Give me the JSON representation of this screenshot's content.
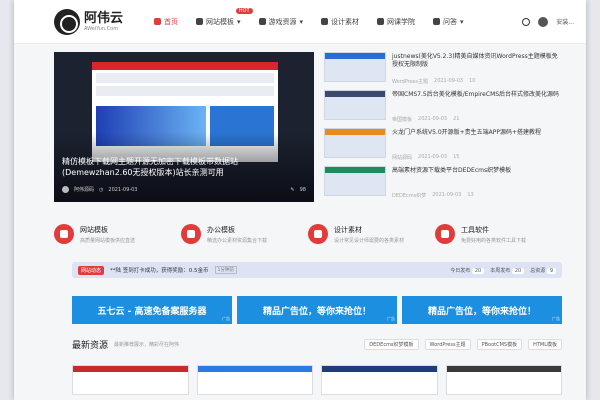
{
  "brand": {
    "name": "阿伟云",
    "domain": "AWeiYun.Com"
  },
  "nav": {
    "items": [
      {
        "label": "首页"
      },
      {
        "label": "网站模板"
      },
      {
        "label": "游戏资源"
      },
      {
        "label": "设计素材"
      },
      {
        "label": "网课学院"
      },
      {
        "label": "问答"
      }
    ],
    "hot_badge": "HOT",
    "user_label": "安装..."
  },
  "hero": {
    "title": "精仿模板下载网主题开源无加密下载模板带数据站(Demewzhan2.60无授权版本)站长亲测可用",
    "author": "阿伟源码",
    "date": "2021-09-03",
    "comments": "98"
  },
  "side_list": [
    {
      "title": "justnews(美化V5.2.3)精美自媒体资讯WordPress主题模板免授权无限制版",
      "cat": "WordPress主题",
      "date": "2021-09-03",
      "views": "10"
    },
    {
      "title": "帝国CMS7.5后台美化模板/EmpireCMS后台样式修改美化源码",
      "cat": "帝国模板",
      "date": "2021-09-03",
      "views": "21"
    },
    {
      "title": "火龙门户系统V5.0开源版+贵生五端APP源码+搭建教程",
      "cat": "网站源码",
      "date": "2021-09-03",
      "views": "15"
    },
    {
      "title": "高端素材资源下载类平台DEDEcms织梦模板",
      "cat": "DEDEcms织梦",
      "date": "2021-09-03",
      "views": "13"
    }
  ],
  "categories": [
    {
      "name": "网站模板",
      "desc": "高质量网站模板供应直送"
    },
    {
      "name": "办公模板",
      "desc": "精选办公素材资源集合下载"
    },
    {
      "name": "设计素材",
      "desc": "设计常见设计师需要的各类素材"
    },
    {
      "name": "工具软件",
      "desc": "免费好用的各类软件工具下载"
    }
  ],
  "notice": {
    "badge": "网站动态",
    "text": "**陆 签到打卡成功，获得奖励：0.5金币",
    "tag": "1分钟前",
    "stats": [
      {
        "label": "今日发布",
        "value": "20"
      },
      {
        "label": "本周发布",
        "value": "20"
      },
      {
        "label": "总资源",
        "value": "9"
      }
    ]
  },
  "ads": [
    {
      "label": "五七云 - 高速免备案服务器",
      "tag": "广告"
    },
    {
      "label": "精品广告位，等你来抢位！",
      "tag": "广告"
    },
    {
      "label": "精品广告位，等你来抢位！",
      "tag": "广告"
    }
  ],
  "newest": {
    "title": "最新资源",
    "subtitle": "最新推荐展示，精彩尽在阿伟",
    "tabs": [
      "DEDEcms织梦模板",
      "WordPress主题",
      "PBootCMS模板",
      "HTML模板"
    ]
  },
  "colors": {
    "accent": "#e23b3b",
    "ad_blue": "#1d8fe0",
    "notice_bg": "#dde3f5"
  }
}
